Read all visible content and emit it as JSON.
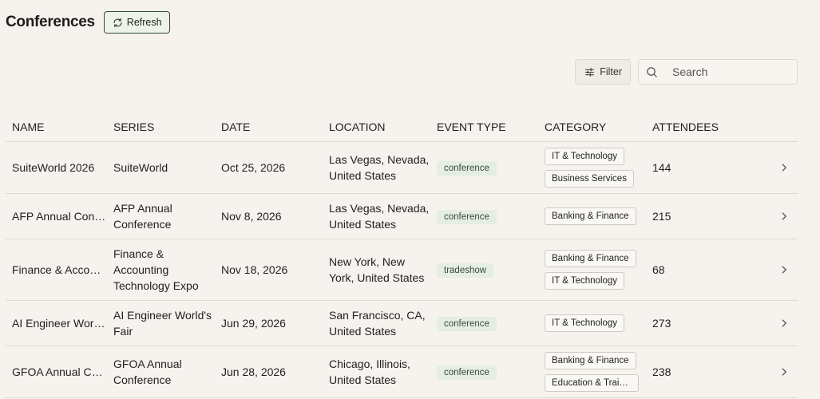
{
  "header": {
    "title": "Conferences",
    "refresh_label": "Refresh"
  },
  "toolbar": {
    "filter_label": "Filter",
    "search_placeholder": "Search"
  },
  "table": {
    "columns": [
      "NAME",
      "SERIES",
      "DATE",
      "LOCATION",
      "EVENT TYPE",
      "CATEGORY",
      "ATTENDEES"
    ],
    "rows": [
      {
        "name": "SuiteWorld 2026",
        "series": "SuiteWorld",
        "date": "Oct 25, 2026",
        "location": "Las Vegas, Nevada, United States",
        "event_type": "conference",
        "categories": [
          "IT & Technology",
          "Business Services"
        ],
        "attendees": "144"
      },
      {
        "name": "AFP Annual Confe...",
        "series": "AFP Annual Conference",
        "date": "Nov 8, 2026",
        "location": "Las Vegas, Nevada, United States",
        "event_type": "conference",
        "categories": [
          "Banking & Finance"
        ],
        "attendees": "215"
      },
      {
        "name": "Finance & Account...",
        "series": "Finance & Accounting Technology Expo",
        "date": "Nov 18, 2026",
        "location": "New York, New York, United States",
        "event_type": "tradeshow",
        "categories": [
          "Banking & Finance",
          "IT & Technology"
        ],
        "attendees": "68"
      },
      {
        "name": "AI Engineer World'...",
        "series": "AI Engineer World's Fair",
        "date": "Jun 29, 2026",
        "location": "San Francisco, CA, United States",
        "event_type": "conference",
        "categories": [
          "IT & Technology"
        ],
        "attendees": "273"
      },
      {
        "name": "GFOA Annual Con...",
        "series": "GFOA Annual Conference",
        "date": "Jun 28, 2026",
        "location": "Chicago, Illinois, United States",
        "event_type": "conference",
        "categories": [
          "Banking & Finance",
          "Education & Traini..."
        ],
        "attendees": "238"
      }
    ]
  },
  "icons": {
    "refresh": "refresh-icon",
    "filter": "sliders-icon",
    "search": "search-icon",
    "row_arrow": "chevron-right-icon"
  }
}
